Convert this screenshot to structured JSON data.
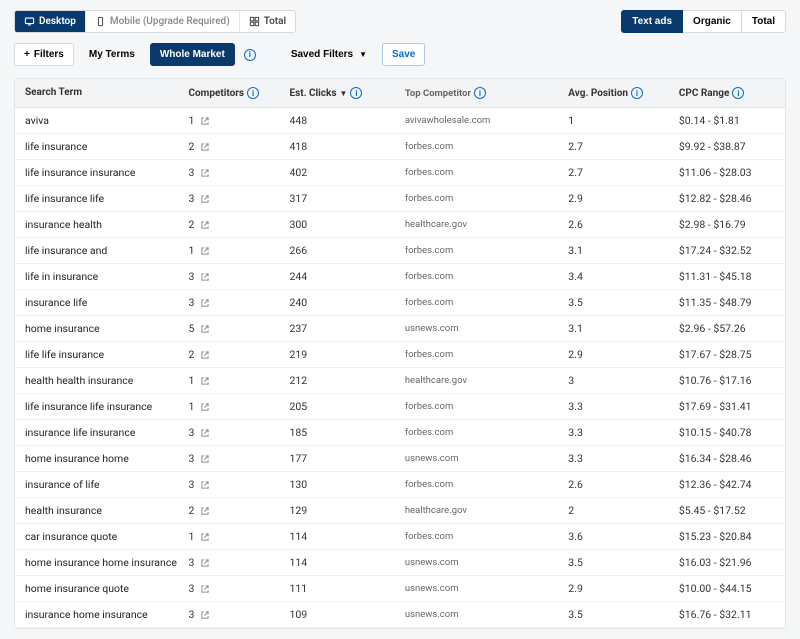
{
  "viewTabs": {
    "desktop": "Desktop",
    "mobile": "Mobile (Upgrade Required)",
    "total": "Total"
  },
  "rightTabs": {
    "text": "Text ads",
    "organic": "Organic",
    "total": "Total"
  },
  "filterBar": {
    "filters": "Filters",
    "myTerms": "My Terms",
    "whole": "Whole Market",
    "saved": "Saved Filters",
    "save": "Save"
  },
  "headers": {
    "term": "Search Term",
    "comp": "Competitors",
    "clicks": "Est. Clicks",
    "top": "Top Competitor",
    "pos": "Avg. Position",
    "cpc": "CPC Range"
  },
  "rows": [
    {
      "term": "aviva",
      "comp": "1",
      "clicks": "448",
      "top": "avivawholesale.com",
      "pos": "1",
      "cpc": "$0.14 - $1.81"
    },
    {
      "term": "life insurance",
      "comp": "2",
      "clicks": "418",
      "top": "forbes.com",
      "pos": "2.7",
      "cpc": "$9.92 - $38.87"
    },
    {
      "term": "life insurance insurance",
      "comp": "3",
      "clicks": "402",
      "top": "forbes.com",
      "pos": "2.7",
      "cpc": "$11.06 - $28.03"
    },
    {
      "term": "life insurance life",
      "comp": "3",
      "clicks": "317",
      "top": "forbes.com",
      "pos": "2.9",
      "cpc": "$12.82 - $28.46"
    },
    {
      "term": "insurance health",
      "comp": "2",
      "clicks": "300",
      "top": "healthcare.gov",
      "pos": "2.6",
      "cpc": "$2.98 - $16.79"
    },
    {
      "term": "life insurance and",
      "comp": "1",
      "clicks": "266",
      "top": "forbes.com",
      "pos": "3.1",
      "cpc": "$17.24 - $32.52"
    },
    {
      "term": "life in insurance",
      "comp": "3",
      "clicks": "244",
      "top": "forbes.com",
      "pos": "3.4",
      "cpc": "$11.31 - $45.18"
    },
    {
      "term": "insurance life",
      "comp": "3",
      "clicks": "240",
      "top": "forbes.com",
      "pos": "3.5",
      "cpc": "$11.35 - $48.79"
    },
    {
      "term": "home insurance",
      "comp": "5",
      "clicks": "237",
      "top": "usnews.com",
      "pos": "3.1",
      "cpc": "$2.96 - $57.26"
    },
    {
      "term": "life life insurance",
      "comp": "2",
      "clicks": "219",
      "top": "forbes.com",
      "pos": "2.9",
      "cpc": "$17.67 - $28.75"
    },
    {
      "term": "health health insurance",
      "comp": "1",
      "clicks": "212",
      "top": "healthcare.gov",
      "pos": "3",
      "cpc": "$10.76 - $17.16"
    },
    {
      "term": "life insurance life insurance",
      "comp": "1",
      "clicks": "205",
      "top": "forbes.com",
      "pos": "3.3",
      "cpc": "$17.69 - $31.41"
    },
    {
      "term": "insurance life insurance",
      "comp": "3",
      "clicks": "185",
      "top": "forbes.com",
      "pos": "3.3",
      "cpc": "$10.15 - $40.78"
    },
    {
      "term": "home insurance home",
      "comp": "3",
      "clicks": "177",
      "top": "usnews.com",
      "pos": "3.3",
      "cpc": "$16.34 - $28.46"
    },
    {
      "term": "insurance of life",
      "comp": "3",
      "clicks": "130",
      "top": "forbes.com",
      "pos": "2.6",
      "cpc": "$12.36 - $42.74"
    },
    {
      "term": "health insurance",
      "comp": "2",
      "clicks": "129",
      "top": "healthcare.gov",
      "pos": "2",
      "cpc": "$5.45 - $17.52"
    },
    {
      "term": "car insurance quote",
      "comp": "1",
      "clicks": "114",
      "top": "forbes.com",
      "pos": "3.6",
      "cpc": "$15.23 - $20.84"
    },
    {
      "term": "home insurance home insurance",
      "comp": "3",
      "clicks": "114",
      "top": "usnews.com",
      "pos": "3.5",
      "cpc": "$16.03 - $21.96"
    },
    {
      "term": "home insurance quote",
      "comp": "3",
      "clicks": "111",
      "top": "usnews.com",
      "pos": "2.9",
      "cpc": "$10.00 - $44.15"
    },
    {
      "term": "insurance home insurance",
      "comp": "3",
      "clicks": "109",
      "top": "usnews.com",
      "pos": "3.5",
      "cpc": "$16.76 - $32.11"
    }
  ]
}
